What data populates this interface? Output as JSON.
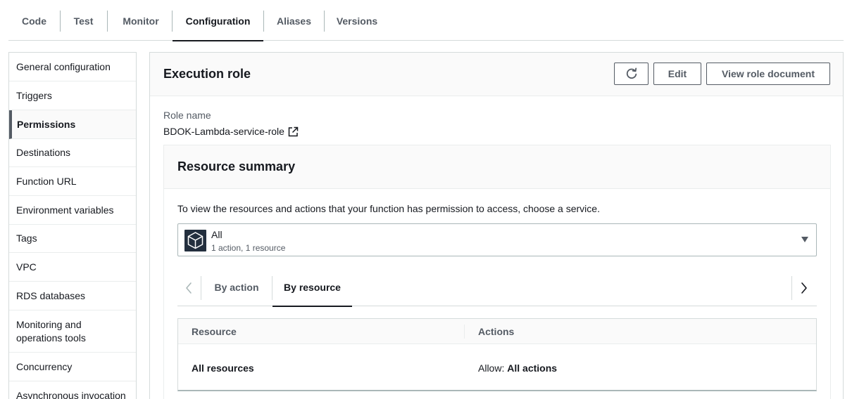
{
  "top_tabs": [
    "Code",
    "Test",
    "Monitor",
    "Configuration",
    "Aliases",
    "Versions"
  ],
  "active_top_tab": "Configuration",
  "sidebar": {
    "items": [
      {
        "label": "General configuration"
      },
      {
        "label": "Triggers"
      },
      {
        "label": "Permissions",
        "active": true
      },
      {
        "label": "Destinations"
      },
      {
        "label": "Function URL"
      },
      {
        "label": "Environment variables"
      },
      {
        "label": "Tags"
      },
      {
        "label": "VPC"
      },
      {
        "label": "RDS databases"
      },
      {
        "label": "Monitoring and\noperations tools"
      },
      {
        "label": "Concurrency"
      },
      {
        "label": "Asynchronous invocation"
      }
    ]
  },
  "execution_role": {
    "title": "Execution role",
    "refresh_icon": "refresh-icon",
    "edit_label": "Edit",
    "view_doc_label": "View role document",
    "role_name_label": "Role name",
    "role_name": "BDOK-Lambda-service-role",
    "external_link_icon": "external-link-icon"
  },
  "resource_summary": {
    "title": "Resource summary",
    "description": "To view the resources and actions that your function has permission to access, choose a service.",
    "service_select": {
      "icon": "service-cube-icon",
      "name": "All",
      "meta": "1 action, 1 resource"
    },
    "tabs": [
      "By action",
      "By resource"
    ],
    "active_tab": "By resource",
    "table": {
      "headers": [
        "Resource",
        "Actions"
      ],
      "rows": [
        {
          "resource": "All resources",
          "action_prefix": "Allow:",
          "action_value": "All actions"
        }
      ]
    }
  },
  "colors": {
    "text": "#16191f",
    "secondary_text": "#545b64",
    "border": "#d5dbdb",
    "header_bg": "#fafafa",
    "service_icon_bg": "#232f3e"
  }
}
